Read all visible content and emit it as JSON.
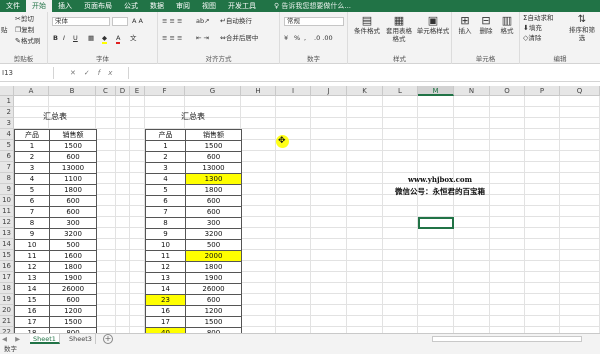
{
  "menu": {
    "items": [
      "文件",
      "开始",
      "插入",
      "页面布局",
      "公式",
      "数据",
      "审阅",
      "视图",
      "开发工具"
    ],
    "active": "开始",
    "tell_me": "告诉我您想要做什么..."
  },
  "ribbon": {
    "clipboard": {
      "cut": "剪切",
      "copy": "复制",
      "format_painter": "格式刷",
      "paste": "贴",
      "label": "剪贴板"
    },
    "font": {
      "name": "宋体",
      "label": "字体",
      "bold": "B",
      "italic": "I",
      "underline": "U"
    },
    "alignment": {
      "wrap": "自动换行",
      "merge": "合并后居中",
      "label": "对齐方式"
    },
    "number": {
      "format": "常规",
      "percent": "%",
      "comma": ",",
      "label": "数字"
    },
    "styles": {
      "conditional": "条件格式",
      "table": "套用表格格式",
      "cell_styles": "单元格样式",
      "label": "样式"
    },
    "cells": {
      "insert": "插入",
      "delete": "删除",
      "format": "格式",
      "label": "单元格"
    },
    "editing": {
      "autosum": "自动求和",
      "fill": "填充",
      "clear": "清除",
      "sort": "排序和筛选",
      "label": "编辑"
    }
  },
  "formula": {
    "name_box": "I13",
    "fx": "fx",
    "value": ""
  },
  "columns": [
    "A",
    "B",
    "C",
    "D",
    "E",
    "F",
    "G",
    "H",
    "I",
    "J",
    "K",
    "L",
    "M",
    "N",
    "O",
    "P",
    "Q"
  ],
  "selected_column": "M",
  "rows": [
    "1",
    "2",
    "3",
    "4",
    "5",
    "6",
    "7",
    "8",
    "9",
    "10",
    "11",
    "12",
    "13",
    "14",
    "15",
    "16",
    "17",
    "18",
    "19",
    "20",
    "21",
    "22"
  ],
  "table1": {
    "title": "汇总表",
    "headers": [
      "产品",
      "销售额"
    ],
    "rows": [
      [
        "1",
        "1500"
      ],
      [
        "2",
        "600"
      ],
      [
        "3",
        "13000"
      ],
      [
        "4",
        "1100"
      ],
      [
        "5",
        "1800"
      ],
      [
        "6",
        "600"
      ],
      [
        "7",
        "600"
      ],
      [
        "8",
        "300"
      ],
      [
        "9",
        "3200"
      ],
      [
        "10",
        "500"
      ],
      [
        "11",
        "1600"
      ],
      [
        "12",
        "1800"
      ],
      [
        "13",
        "1900"
      ],
      [
        "14",
        "26000"
      ],
      [
        "15",
        "600"
      ],
      [
        "16",
        "1200"
      ],
      [
        "17",
        "1500"
      ],
      [
        "18",
        "800"
      ]
    ]
  },
  "table2": {
    "title": "汇总表",
    "headers": [
      "产品",
      "销售额"
    ],
    "rows": [
      [
        "1",
        "1500"
      ],
      [
        "2",
        "600"
      ],
      [
        "3",
        "13000"
      ],
      [
        "4",
        "1300"
      ],
      [
        "5",
        "1800"
      ],
      [
        "6",
        "600"
      ],
      [
        "7",
        "600"
      ],
      [
        "8",
        "300"
      ],
      [
        "9",
        "3200"
      ],
      [
        "10",
        "500"
      ],
      [
        "11",
        "2000"
      ],
      [
        "12",
        "1800"
      ],
      [
        "13",
        "1900"
      ],
      [
        "14",
        "26000"
      ],
      [
        "23",
        "600"
      ],
      [
        "16",
        "1200"
      ],
      [
        "17",
        "1500"
      ],
      [
        "40",
        "800"
      ]
    ],
    "highlighted": [
      [
        3,
        1
      ],
      [
        10,
        1
      ],
      [
        14,
        0
      ],
      [
        17,
        0
      ]
    ],
    "highlight_color": "#ffff00"
  },
  "watermark": {
    "url": "www.yhjbox.com",
    "wechat": "微信公号：永恒君的百宝箱"
  },
  "sheets": {
    "tabs": [
      "Sheet1",
      "Sheet3"
    ],
    "active": "Sheet1",
    "add": "+"
  },
  "status": {
    "mode": "数字"
  },
  "accent": "#217346"
}
